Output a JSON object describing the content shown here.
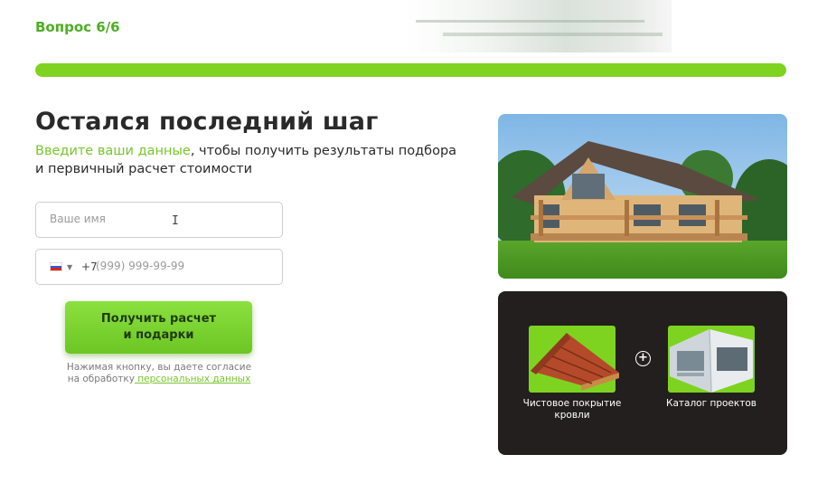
{
  "step": "Вопрос 6/6",
  "progress": 1.0,
  "colors": {
    "accent": "#7ed321",
    "accent_text": "#4caf22",
    "dark_card": "#231f1f"
  },
  "title": "Остался последний шаг",
  "subtitle": {
    "accent": "Введите ваши данные",
    "rest": ", чтобы получить результаты подбора и первичный расчет стоимости"
  },
  "form": {
    "name_placeholder": "Ваше имя",
    "phone_country": "ru-flag-icon",
    "phone_code": "+7",
    "phone_placeholder": "(999) 999-99-99",
    "submit_line1": "Получить расчет",
    "submit_line2": "и подарки"
  },
  "consent": {
    "text": "Нажимая кнопку, вы даете согласие на обработку",
    "link": " персональных данных"
  },
  "bonuses": [
    {
      "label": "Чистовое покрытие кровли",
      "icon": "roof-icon"
    },
    {
      "label": "Каталог проектов",
      "icon": "catalog-icon"
    }
  ]
}
